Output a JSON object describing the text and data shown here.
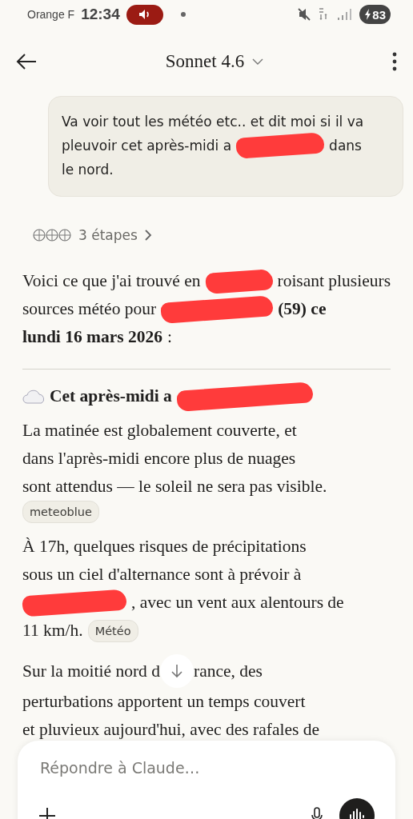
{
  "status_bar": {
    "carrier": "Orange F",
    "time": "12:34",
    "battery": "83"
  },
  "header": {
    "title": "Sonnet 4.6"
  },
  "user_message": {
    "lines": [
      [
        {
          "kind": "text",
          "text": "Va voir tout les météo etc.. et dit moi si il va"
        }
      ],
      [
        {
          "kind": "text",
          "text": "pleuvoir cet après-midi a"
        },
        {
          "kind": "redaction"
        },
        {
          "kind": "text",
          "text": "dans"
        }
      ],
      [
        {
          "kind": "text",
          "text": "le nord."
        }
      ]
    ]
  },
  "steps": {
    "label": "3 étapes"
  },
  "response": [
    {
      "kind": "paragraph",
      "lines": [
        [
          {
            "kind": "text",
            "text": "Voici ce que j'ai trouvé en",
            "bold": false
          },
          {
            "kind": "redaction"
          },
          {
            "kind": "text",
            "text": "roisant plusieurs",
            "bold": false
          }
        ],
        [
          {
            "kind": "text",
            "text": "sources météo pour",
            "bold": false
          },
          {
            "kind": "redaction"
          },
          {
            "kind": "text",
            "text": "(59) ce",
            "bold": true
          }
        ],
        [
          {
            "kind": "text",
            "text": "lundi 16 mars 2026",
            "bold": true
          },
          {
            "kind": "text",
            "text": ":",
            "bold": false
          }
        ]
      ]
    },
    {
      "kind": "divider"
    },
    {
      "kind": "heading",
      "lines": [
        [
          {
            "kind": "text",
            "text": "Cet après-midi a",
            "bold": true
          },
          {
            "kind": "redaction"
          }
        ]
      ]
    },
    {
      "kind": "paragraph",
      "lines": [
        [
          {
            "kind": "text",
            "text": "La matinée est globalement couverte, et",
            "bold": false
          }
        ],
        [
          {
            "kind": "text",
            "text": "dans l'après-midi encore plus de nuages",
            "bold": false
          }
        ],
        [
          {
            "kind": "text",
            "text": "sont attendus — le soleil ne sera pas visible.",
            "bold": false
          }
        ],
        [
          {
            "kind": "chip",
            "text": "meteoblue"
          }
        ]
      ]
    },
    {
      "kind": "paragraph",
      "lines": [
        [
          {
            "kind": "text",
            "text": "À 17h, quelques risques de précipitations",
            "bold": false
          }
        ],
        [
          {
            "kind": "text",
            "text": "sous un ciel d'alternance sont à prévoir à",
            "bold": false
          }
        ],
        [
          {
            "kind": "redaction"
          },
          {
            "kind": "text",
            "text": ", avec un vent aux alentours de",
            "bold": false
          }
        ],
        [
          {
            "kind": "text",
            "text": "11 km/h.",
            "bold": false
          },
          {
            "kind": "chip",
            "text": "Météo"
          }
        ]
      ]
    },
    {
      "kind": "paragraph",
      "lines": [
        [
          {
            "kind": "text",
            "text": "Sur la moitié nord d",
            "bold": false
          },
          {
            "kind": "scroll_button"
          },
          {
            "kind": "text",
            "text": "rance, des",
            "bold": false
          }
        ],
        [
          {
            "kind": "text",
            "text": "perturbations apportent un temps couvert",
            "bold": false
          }
        ],
        [
          {
            "kind": "text",
            "text": "et pluvieux aujourd'hui, avec des rafales de",
            "bold": false
          }
        ]
      ]
    }
  ],
  "composer": {
    "placeholder": "Répondre à Claude…"
  }
}
